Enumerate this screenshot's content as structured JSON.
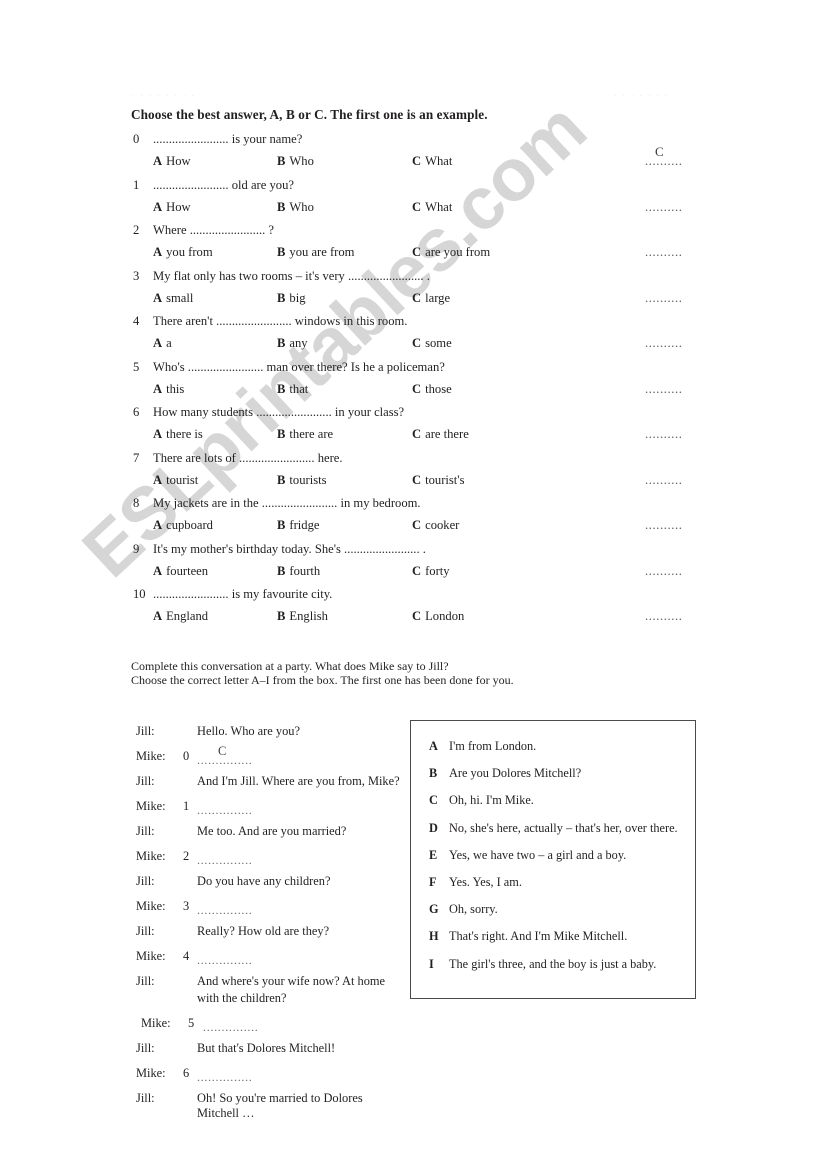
{
  "page": {
    "header_ghost_left": ". . . . . . . .",
    "header_ghost_right": ". . . . . . .",
    "watermark": "ESLprintables.com"
  },
  "section1": {
    "instruction": "Choose the best answer, A, B or C. The first one is an example.",
    "answer_blank": "..........",
    "questions": [
      {
        "num": "0",
        "stem": "........................ is your name?",
        "options": [
          {
            "letter": "A",
            "text": "How"
          },
          {
            "letter": "B",
            "text": "Who"
          },
          {
            "letter": "C",
            "text": "What"
          }
        ],
        "answer": "C"
      },
      {
        "num": "1",
        "stem": "........................ old are you?",
        "options": [
          {
            "letter": "A",
            "text": "How"
          },
          {
            "letter": "B",
            "text": "Who"
          },
          {
            "letter": "C",
            "text": "What"
          }
        ],
        "answer": ""
      },
      {
        "num": "2",
        "stem": "Where ........................ ?",
        "options": [
          {
            "letter": "A",
            "text": "you from"
          },
          {
            "letter": "B",
            "text": "you are from"
          },
          {
            "letter": "C",
            "text": "are you from"
          }
        ],
        "answer": ""
      },
      {
        "num": "3",
        "stem": "My flat only has two rooms – it's very ........................ .",
        "options": [
          {
            "letter": "A",
            "text": "small"
          },
          {
            "letter": "B",
            "text": "big"
          },
          {
            "letter": "C",
            "text": "large"
          }
        ],
        "answer": ""
      },
      {
        "num": "4",
        "stem": "There aren't ........................ windows in this room.",
        "options": [
          {
            "letter": "A",
            "text": "a"
          },
          {
            "letter": "B",
            "text": "any"
          },
          {
            "letter": "C",
            "text": "some"
          }
        ],
        "answer": ""
      },
      {
        "num": "5",
        "stem": "Who's ........................ man over there? Is he a policeman?",
        "options": [
          {
            "letter": "A",
            "text": "this"
          },
          {
            "letter": "B",
            "text": "that"
          },
          {
            "letter": "C",
            "text": "those"
          }
        ],
        "answer": ""
      },
      {
        "num": "6",
        "stem": "How many students ........................ in your class?",
        "options": [
          {
            "letter": "A",
            "text": "there is"
          },
          {
            "letter": "B",
            "text": "there are"
          },
          {
            "letter": "C",
            "text": "are there"
          }
        ],
        "answer": ""
      },
      {
        "num": "7",
        "stem": "There are lots of ........................ here.",
        "options": [
          {
            "letter": "A",
            "text": "tourist"
          },
          {
            "letter": "B",
            "text": "tourists"
          },
          {
            "letter": "C",
            "text": "tourist's"
          }
        ],
        "answer": ""
      },
      {
        "num": "8",
        "stem": "My jackets are in the ........................ in my bedroom.",
        "options": [
          {
            "letter": "A",
            "text": "cupboard"
          },
          {
            "letter": "B",
            "text": "fridge"
          },
          {
            "letter": "C",
            "text": "cooker"
          }
        ],
        "answer": ""
      },
      {
        "num": "9",
        "stem": "It's my mother's birthday today. She's ........................ .",
        "options": [
          {
            "letter": "A",
            "text": "fourteen"
          },
          {
            "letter": "B",
            "text": "fourth"
          },
          {
            "letter": "C",
            "text": "forty"
          }
        ],
        "answer": ""
      },
      {
        "num": "10",
        "stem": "........................ is my favourite city.",
        "options": [
          {
            "letter": "A",
            "text": "England"
          },
          {
            "letter": "B",
            "text": "English"
          },
          {
            "letter": "C",
            "text": "London"
          }
        ],
        "answer": ""
      }
    ]
  },
  "section2": {
    "instruction_line1": "Complete this conversation at a party. What does Mike say to Jill?",
    "instruction_line2": "Choose the correct letter A–I from the box. The first one has been done for you.",
    "blank_dots": "...............",
    "dialogue": [
      {
        "speaker": "Jill:",
        "num": "",
        "text": "Hello. Who are you?",
        "text2": "",
        "blank": false,
        "mark": ""
      },
      {
        "speaker": "Mike:",
        "num": "0",
        "text": "",
        "text2": "",
        "blank": true,
        "mark": "C"
      },
      {
        "speaker": "Jill:",
        "num": "",
        "text": "And I'm Jill. Where are you from, Mike?",
        "text2": "",
        "blank": false,
        "mark": ""
      },
      {
        "speaker": "Mike:",
        "num": "1",
        "text": "",
        "text2": "",
        "blank": true,
        "mark": ""
      },
      {
        "speaker": "Jill:",
        "num": "",
        "text": "Me too. And are you married?",
        "text2": "",
        "blank": false,
        "mark": ""
      },
      {
        "speaker": "Mike:",
        "num": "2",
        "text": "",
        "text2": "",
        "blank": true,
        "mark": ""
      },
      {
        "speaker": "Jill:",
        "num": "",
        "text": "Do you have any children?",
        "text2": "",
        "blank": false,
        "mark": ""
      },
      {
        "speaker": "Mike:",
        "num": "3",
        "text": "",
        "text2": "",
        "blank": true,
        "mark": ""
      },
      {
        "speaker": "Jill:",
        "num": "",
        "text": "Really? How old are they?",
        "text2": "",
        "blank": false,
        "mark": ""
      },
      {
        "speaker": "Mike:",
        "num": "4",
        "text": "",
        "text2": "",
        "blank": true,
        "mark": ""
      },
      {
        "speaker": "Jill:",
        "num": "",
        "text": "And where's your wife now? At home",
        "text2": "with the children?",
        "blank": false,
        "mark": ""
      },
      {
        "speaker": "Mike:",
        "num": "5",
        "text": "",
        "text2": "",
        "blank": true,
        "mark": ""
      },
      {
        "speaker": "Jill:",
        "num": "",
        "text": "But that's Dolores Mitchell!",
        "text2": "",
        "blank": false,
        "mark": ""
      },
      {
        "speaker": "Mike:",
        "num": "6",
        "text": "",
        "text2": "",
        "blank": true,
        "mark": ""
      },
      {
        "speaker": "Jill:",
        "num": "",
        "text": "Oh! So you're married to Dolores Mitchell …",
        "text2": "",
        "blank": false,
        "mark": ""
      }
    ],
    "answer_box": [
      {
        "letter": "A",
        "text": "I'm from London."
      },
      {
        "letter": "B",
        "text": "Are you Dolores Mitchell?"
      },
      {
        "letter": "C",
        "text": "Oh, hi. I'm Mike."
      },
      {
        "letter": "D",
        "text": "No, she's here, actually – that's her, over there."
      },
      {
        "letter": "E",
        "text": "Yes, we have two – a girl and a boy."
      },
      {
        "letter": "F",
        "text": "Yes. Yes, I am."
      },
      {
        "letter": "G",
        "text": "Oh, sorry."
      },
      {
        "letter": "H",
        "text": "That's right. And I'm Mike Mitchell."
      },
      {
        "letter": "I",
        "text": "The girl's three, and the boy is just a baby."
      }
    ]
  }
}
